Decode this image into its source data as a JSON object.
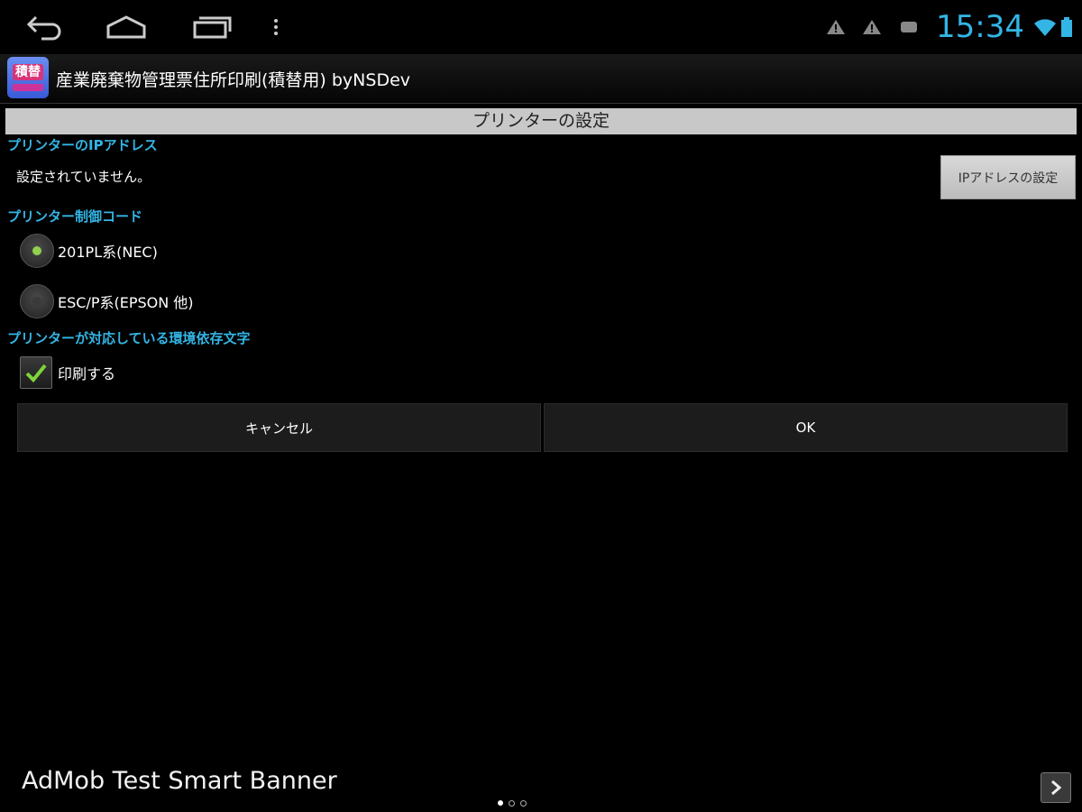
{
  "status_bar": {
    "time": "15:34",
    "colors": {
      "clock": "#33b5e5"
    },
    "icons": [
      "back-icon",
      "home-icon",
      "recent-apps-icon",
      "overflow-menu-icon",
      "warning-icon",
      "warning-icon",
      "notification-icon",
      "wifi-icon",
      "battery-icon"
    ]
  },
  "action_bar": {
    "app_icon_text": "積替",
    "title": "産業廃棄物管理票住所印刷(積替用) byNSDev"
  },
  "dialog": {
    "title": "プリンターの設定",
    "ip_section": {
      "label": "プリンターのIPアドレス",
      "value": "設定されていません。",
      "button": "IPアドレスの設定"
    },
    "control_code_section": {
      "label": "プリンター制御コード",
      "options": [
        {
          "label": "201PL系(NEC)",
          "selected": true
        },
        {
          "label": "ESC/P系(EPSON 他)",
          "selected": false
        }
      ]
    },
    "env_chars_section": {
      "label": "プリンターが対応している環境依存文字",
      "checkbox": {
        "label": "印刷する",
        "checked": true
      }
    },
    "buttons": {
      "cancel": "キャンセル",
      "ok": "OK"
    },
    "colors": {
      "section_label": "#33b5e5",
      "radio_selected": "#8fd14f",
      "check": "#7fd33a"
    }
  },
  "ad_banner": {
    "text": "AdMob Test Smart Banner",
    "page_dots": 3,
    "active_dot": 0
  }
}
